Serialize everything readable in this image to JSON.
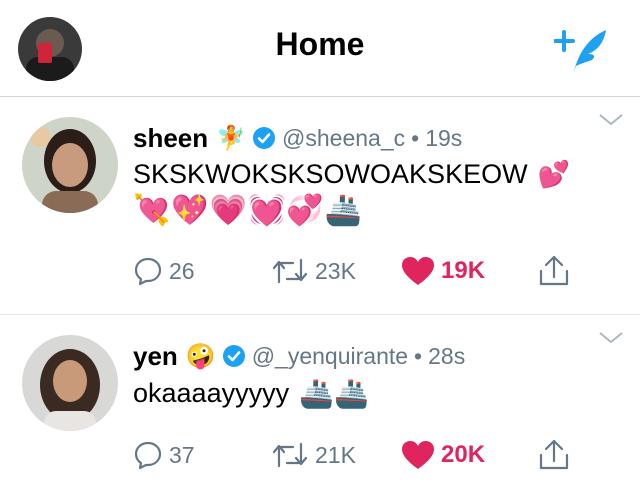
{
  "header": {
    "title": "Home",
    "profile_icon": "profile-avatar",
    "compose_icon": "compose-tweet-icon",
    "accent": "#1da1f2"
  },
  "tweets": [
    {
      "name": "sheen",
      "name_emoji": "🧚",
      "verified": true,
      "handle": "@sheena_c",
      "separator": "•",
      "time": "19s",
      "text": "SKSKWOKSKSOWOAKSKEOW",
      "text_emoji": "💕",
      "emoji_line": "💘💖💗💓💞🚢",
      "replies": "26",
      "retweets": "23K",
      "likes": "19K",
      "liked": true
    },
    {
      "name": "yen",
      "name_emoji": "🤪",
      "verified": true,
      "handle": "@_yenquirante",
      "separator": "•",
      "time": "28s",
      "text": "okaaaayyyyy",
      "text_emoji": "🚢🚢",
      "replies": "37",
      "retweets": "21K",
      "likes": "20K",
      "liked": true
    }
  ],
  "colors": {
    "like": "#e0245e",
    "muted": "#657786",
    "verified": "#1da1f2"
  }
}
